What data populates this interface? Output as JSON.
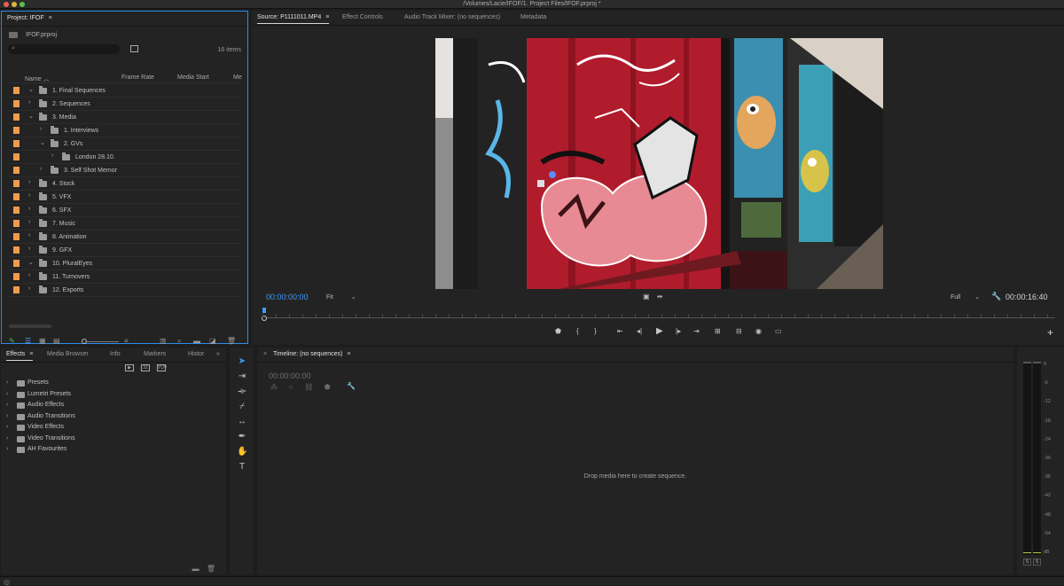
{
  "window": {
    "title": "/Volumes/Lacie/IFOF/1. Project Files/IFOF.prproj *"
  },
  "project": {
    "tab_label": "Project: IFOF",
    "file_name": "IFOF.prproj",
    "items_count": "16 items",
    "search_placeholder": "",
    "columns": {
      "name": "Name",
      "frame_rate": "Frame Rate",
      "media_start": "Media Start",
      "more": "Me"
    },
    "rows": [
      {
        "name": "1. Final Sequences",
        "level": 0,
        "expanded": true
      },
      {
        "name": "2. Sequences",
        "level": 0,
        "expanded": false
      },
      {
        "name": "3. Media",
        "level": 0,
        "expanded": true
      },
      {
        "name": "1. Interviews",
        "level": 1,
        "expanded": false
      },
      {
        "name": "2. GVs",
        "level": 1,
        "expanded": true
      },
      {
        "name": "London 28.10.",
        "level": 2,
        "expanded": false
      },
      {
        "name": "3. Self Shot Memor",
        "level": 1,
        "expanded": false
      },
      {
        "name": "4. Stock",
        "level": 0,
        "expanded": false
      },
      {
        "name": "5. VFX",
        "level": 0,
        "expanded": false
      },
      {
        "name": "6. SFX",
        "level": 0,
        "expanded": false
      },
      {
        "name": "7. Music",
        "level": 0,
        "expanded": false
      },
      {
        "name": "8. Animation",
        "level": 0,
        "expanded": false
      },
      {
        "name": "9. GFX",
        "level": 0,
        "expanded": false
      },
      {
        "name": "10. PluralEyes",
        "level": 0,
        "expanded": true
      },
      {
        "name": "11. Turnovers",
        "level": 0,
        "expanded": false
      },
      {
        "name": "12. Exports",
        "level": 0,
        "expanded": false
      }
    ]
  },
  "source_tabs": [
    {
      "label": "Source: P1111011.MP4"
    },
    {
      "label": "Effect Controls"
    },
    {
      "label": "Audio Track Mixer: (no sequences)"
    },
    {
      "label": "Metadata"
    }
  ],
  "source": {
    "timecode_in": "00:00:00:00",
    "timecode_duration": "00:00:16:40",
    "zoom": "Fit",
    "resolution": "Full"
  },
  "effects": {
    "tabs": [
      {
        "label": "Effects"
      },
      {
        "label": "Media Browser"
      },
      {
        "label": "Info"
      },
      {
        "label": "Markers"
      },
      {
        "label": "Histor"
      }
    ],
    "items": [
      "Presets",
      "Lumetri Presets",
      "Audio Effects",
      "Audio Transitions",
      "Video Effects",
      "Video Transitions",
      "AH Favourites"
    ]
  },
  "timeline": {
    "tab_label": "Timeline: (no sequences)",
    "timecode": "00:00:00:00",
    "drop_text": "Drop media here to create sequence."
  },
  "meter": {
    "scale": [
      "0",
      "-6",
      "-12",
      "-18",
      "-24",
      "-30",
      "-36",
      "-42",
      "-48",
      "-54",
      "dB"
    ],
    "solo_left": "S",
    "solo_right": "S"
  },
  "colors": {
    "accent": "#2d8ceb",
    "timecode": "#3e9bff",
    "label_orange": "#f09b4b"
  }
}
